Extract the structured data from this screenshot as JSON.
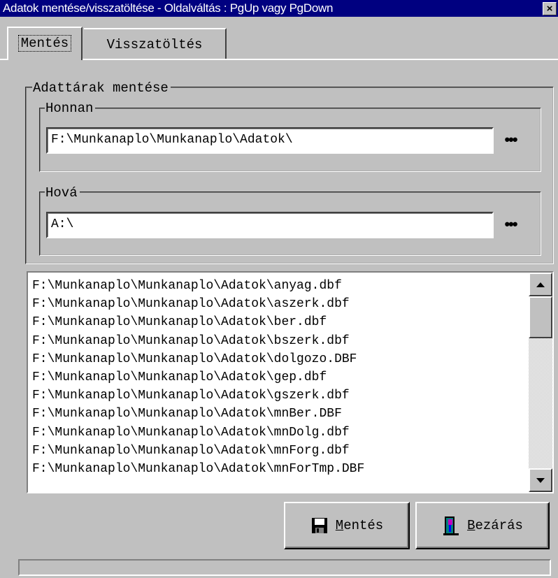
{
  "window": {
    "title": "Adatok mentése/visszatöltése - Oldalváltás : PgUp vagy PgDown",
    "close_glyph": "×"
  },
  "tabs": [
    {
      "label": "Mentés",
      "active": true
    },
    {
      "label": "Visszatöltés",
      "active": false
    }
  ],
  "group": {
    "title": "Adattárak mentése",
    "from": {
      "label": "Honnan",
      "value": "F:\\Munkanaplo\\Munkanaplo\\Adatok\\",
      "browse": "•••"
    },
    "to": {
      "label": "Hová",
      "value": "A:\\",
      "browse": "•••"
    }
  },
  "files": [
    "F:\\Munkanaplo\\Munkanaplo\\Adatok\\anyag.dbf",
    "F:\\Munkanaplo\\Munkanaplo\\Adatok\\aszerk.dbf",
    "F:\\Munkanaplo\\Munkanaplo\\Adatok\\ber.dbf",
    "F:\\Munkanaplo\\Munkanaplo\\Adatok\\bszerk.dbf",
    "F:\\Munkanaplo\\Munkanaplo\\Adatok\\dolgozo.DBF",
    "F:\\Munkanaplo\\Munkanaplo\\Adatok\\gep.dbf",
    "F:\\Munkanaplo\\Munkanaplo\\Adatok\\gszerk.dbf",
    "F:\\Munkanaplo\\Munkanaplo\\Adatok\\mnBer.DBF",
    "F:\\Munkanaplo\\Munkanaplo\\Adatok\\mnDolg.dbf",
    "F:\\Munkanaplo\\Munkanaplo\\Adatok\\mnForg.dbf",
    "F:\\Munkanaplo\\Munkanaplo\\Adatok\\mnForTmp.DBF"
  ],
  "buttons": {
    "save": {
      "mnemonic": "M",
      "rest": "entés",
      "icon": "floppy-disk-icon"
    },
    "close": {
      "mnemonic": "B",
      "rest": "ezárás",
      "icon": "door-exit-icon"
    }
  },
  "colors": {
    "titlebar": "#000080",
    "face": "#c0c0c0"
  }
}
